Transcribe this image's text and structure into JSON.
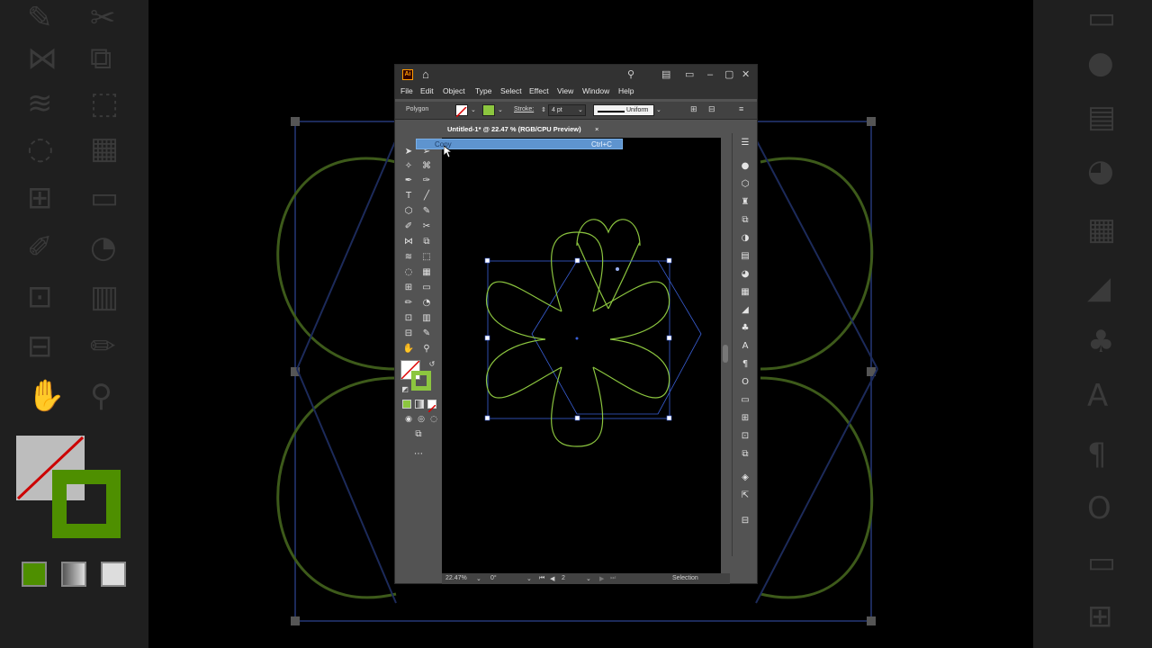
{
  "app": {
    "logo": "Ai",
    "menu": [
      "File",
      "Edit",
      "Object",
      "Type",
      "Select",
      "Effect",
      "View",
      "Window",
      "Help"
    ]
  },
  "control_bar": {
    "selection_type": "Polygon",
    "stroke_label": "Stroke:",
    "stroke_weight": "4 pt",
    "profile": "Uniform"
  },
  "document": {
    "tab_title": "Untitled-1* @ 22.47 % (RGB/CPU Preview)",
    "close": "×"
  },
  "context_menu": {
    "item_label": "Copy",
    "shortcut": "Ctrl+C"
  },
  "status_bar": {
    "zoom": "22.47%",
    "rotation": "0°",
    "artboard": "2",
    "tool": "Selection"
  },
  "colors": {
    "stroke_green": "#8cc63f",
    "selection_blue": "#3a5fd6",
    "ui_gray": "#535353"
  },
  "icons": {
    "home": "home-icon",
    "search": "search-icon",
    "minimize": "minimize-icon",
    "maximize": "maximize-icon",
    "close": "close-icon"
  }
}
